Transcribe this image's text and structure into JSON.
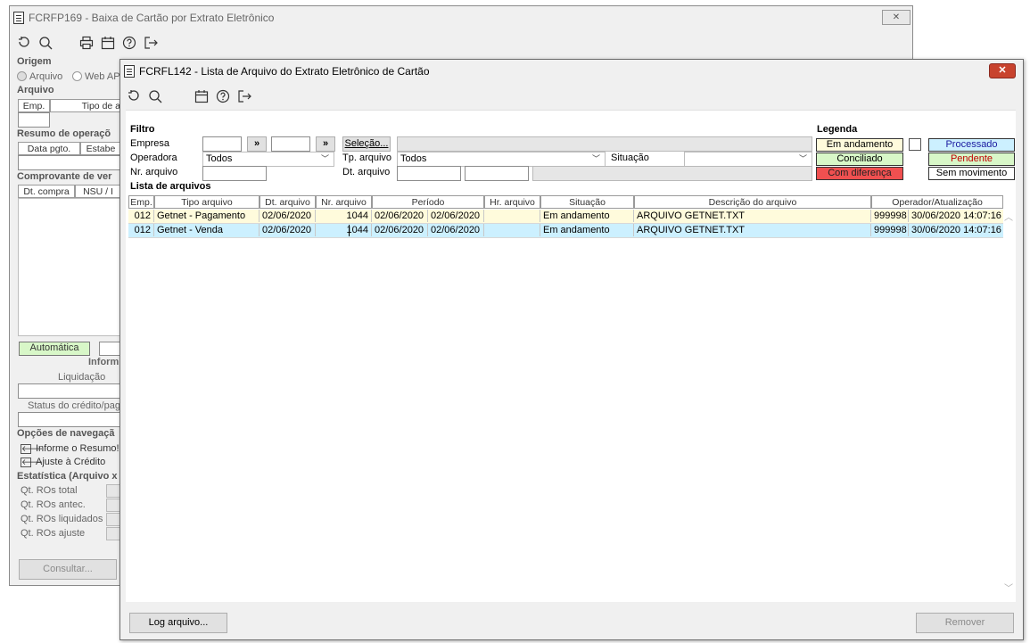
{
  "back_window": {
    "title": "FCRFP169 - Baixa de Cartão por Extrato Eletrônico",
    "close_glyph": "✕",
    "origem": {
      "label": "Origem",
      "option1": "Arquivo",
      "option2": "Web AP"
    },
    "arquivo": {
      "label": "Arquivo",
      "col_emp": "Emp.",
      "col_tipo": "Tipo de a"
    },
    "resumo": {
      "label": "Resumo de operaçõ",
      "col_data": "Data pgto.",
      "col_estab": "Estabe"
    },
    "comprovante": {
      "label": "Comprovante de ver",
      "col_dt": "Dt. compra",
      "col_nsu": "NSU / I"
    },
    "automatica": "Automática",
    "inform": "Inform",
    "liquidacao": "Liquidação",
    "status_credito": "Status do crédito/pag",
    "opcoes": {
      "label": "Opções de navegaçã",
      "item1": "Informe o Resumo!",
      "item2": "Ajuste à Crédito"
    },
    "estatistica": {
      "label": "Estatística (Arquivo x",
      "r1": "Qt. ROs total",
      "r2": "Qt. ROs antec.",
      "r3": "Qt. ROs liquidados",
      "r4": "Qt. ROs ajuste"
    },
    "consultar": "Consultar..."
  },
  "front_window": {
    "title": "FCRFL142 - Lista de Arquivo do Extrato Eletrônico de Cartão",
    "close_glyph": "✕",
    "filtro": {
      "label": "Filtro",
      "empresa": "Empresa",
      "operadora": "Operadora",
      "operadora_value": "Todos",
      "nr_arquivo": "Nr. arquivo",
      "range_btn": "»",
      "selecao": "Seleção...",
      "tp_arquivo": "Tp. arquivo",
      "tp_arquivo_value": "Todos",
      "situacao": "Situação",
      "dt_arquivo": "Dt. arquivo"
    },
    "legenda": {
      "label": "Legenda",
      "em_andamento": "Em andamento",
      "processado": "Processado",
      "conciliado": "Conciliado",
      "pendente": "Pendente",
      "com_diferenca": "Com diferença",
      "sem_movimento": "Sem movimento",
      "colors": {
        "em_andamento": "#fffbdc",
        "conciliado": "#d8f7c8",
        "com_diferenca": "#f05050",
        "processado": "#ccf0ff",
        "pendente": "#d8f7c8"
      }
    },
    "lista": {
      "label": "Lista de arquivos",
      "headers": [
        "Emp.",
        "Tipo arquivo",
        "Dt. arquivo",
        "Nr. arquivo",
        "Período",
        "Hr. arquivo",
        "Situação",
        "Descrição do arquivo",
        "Operador/Atualização"
      ],
      "rows": [
        {
          "emp": "012",
          "tipo": "Getnet - Pagamento",
          "dt": "02/06/2020",
          "nr": "1044",
          "per1": "02/06/2020",
          "per2": "02/06/2020",
          "hr": "",
          "sit": "Em andamento",
          "desc": "ARQUIVO GETNET.TXT",
          "op": "999998",
          "atual": "30/06/2020 14:07:16"
        },
        {
          "emp": "012",
          "tipo": "Getnet - Venda",
          "dt": "02/06/2020",
          "nr": "1044",
          "per1": "02/06/2020",
          "per2": "02/06/2020",
          "hr": "",
          "sit": "Em andamento",
          "desc": "ARQUIVO GETNET.TXT",
          "op": "999998",
          "atual": "30/06/2020 14:07:16"
        }
      ]
    },
    "log_button": "Log arquivo...",
    "remover_button": "Remover"
  }
}
